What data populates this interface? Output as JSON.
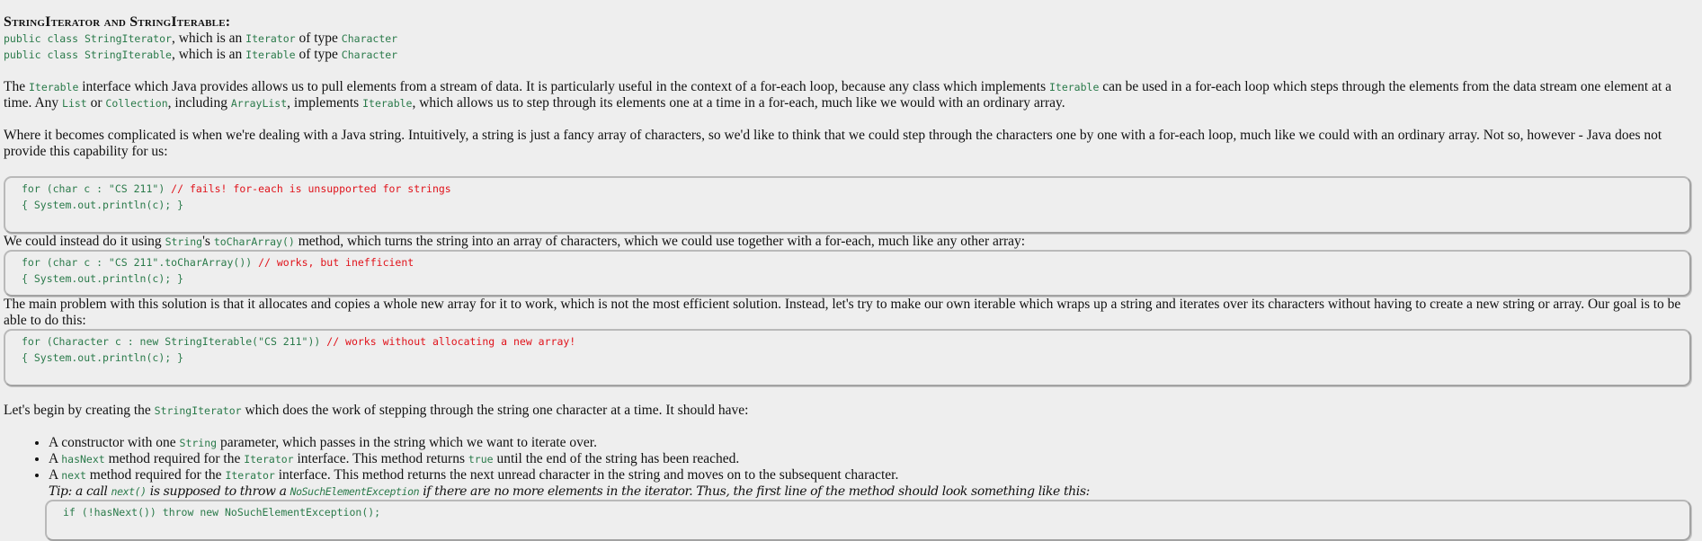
{
  "heading": "StringIterator and StringIterable:",
  "signatures": [
    {
      "code1": "public class StringIterator",
      "text1": ", which is an ",
      "code2": "Iterator",
      "text2": " of type ",
      "code3": "Character"
    },
    {
      "code1": "public class StringIterable",
      "text1": ", which is an ",
      "code2": "Iterable",
      "text2": " of type ",
      "code3": "Character"
    }
  ],
  "para1": {
    "t1": "The ",
    "c1": "Iterable",
    "t2": " interface which Java provides allows us to pull elements from a stream of data. It is particularly useful in the context of a for-each loop, because any class which implements ",
    "c2": "Iterable",
    "t3": " can be used in a for-each loop which steps through the elements from the data stream one element at a time. Any ",
    "c3": "List",
    "t4": " or ",
    "c4": "Collection",
    "t5": ", including ",
    "c5": "ArrayList",
    "t6": ", implements ",
    "c6": "Iterable",
    "t7": ", which allows us to step through its elements one at a time in a for-each, much like we would with an ordinary array."
  },
  "para2": "Where it becomes complicated is when we're dealing with a Java string. Intuitively, a string is just a fancy array of characters, so we'd like to think that we could step through the characters one by one with a for-each loop, much like we could with an ordinary array. Not so, however - Java does not provide this capability for us:",
  "code1": {
    "line1_code": "for (char c : \"CS 211\") ",
    "line1_comment": "// fails! for-each is unsupported for strings",
    "line2": "{ System.out.println(c); }"
  },
  "para3": {
    "t1": "We could instead do it using ",
    "c1": "String",
    "t2": "'s ",
    "c2": "toCharArray()",
    "t3": " method, which turns the string into an array of characters, which we could use together with a for-each, much like any other array:"
  },
  "code2": {
    "line1_code": "for (char c : \"CS 211\".toCharArray()) ",
    "line1_comment": "// works, but inefficient",
    "line2": "{ System.out.println(c); }"
  },
  "para4": "The main problem with this solution is that it allocates and copies a whole new array for it to work, which is not the most efficient solution. Instead, let's try to make our own iterable which wraps up a string and iterates over its characters without having to create a new string or array. Our goal is to be able to do this:",
  "code3": {
    "line1_code": "for (Character c : new StringIterable(\"CS 211\")) ",
    "line1_comment": "// works without allocating a new array!",
    "line2": "{ System.out.println(c); }"
  },
  "para5": {
    "t1": "Let's begin by creating the ",
    "c1": "StringIterator",
    "t2": " which does the work of stepping through the string one character at a time. It should have:"
  },
  "list": [
    {
      "t1": "A constructor with one ",
      "c1": "String",
      "t2": " parameter, which passes in the string which we want to iterate over."
    },
    {
      "t1": "A ",
      "c1": "hasNext",
      "t2": " method required for the ",
      "c2": "Iterator",
      "t3": " interface. This method returns ",
      "c3": "true",
      "t4": " until the end of the string has been reached."
    },
    {
      "t1": "A ",
      "c1": "next",
      "t2": " method required for the ",
      "c2": "Iterator",
      "t3": " interface. This method returns the next unread character in the string and moves on to the subsequent character."
    }
  ],
  "tip": {
    "t1": "Tip: a call ",
    "c1": "next()",
    "t2": " is supposed to throw a ",
    "c2": "NoSuchElementException",
    "t3": " if there are no more elements in the iterator. Thus, the first line of the method should look something like this:"
  },
  "code4": {
    "line1": "if (!hasNext()) throw new NoSuchElementException();"
  }
}
